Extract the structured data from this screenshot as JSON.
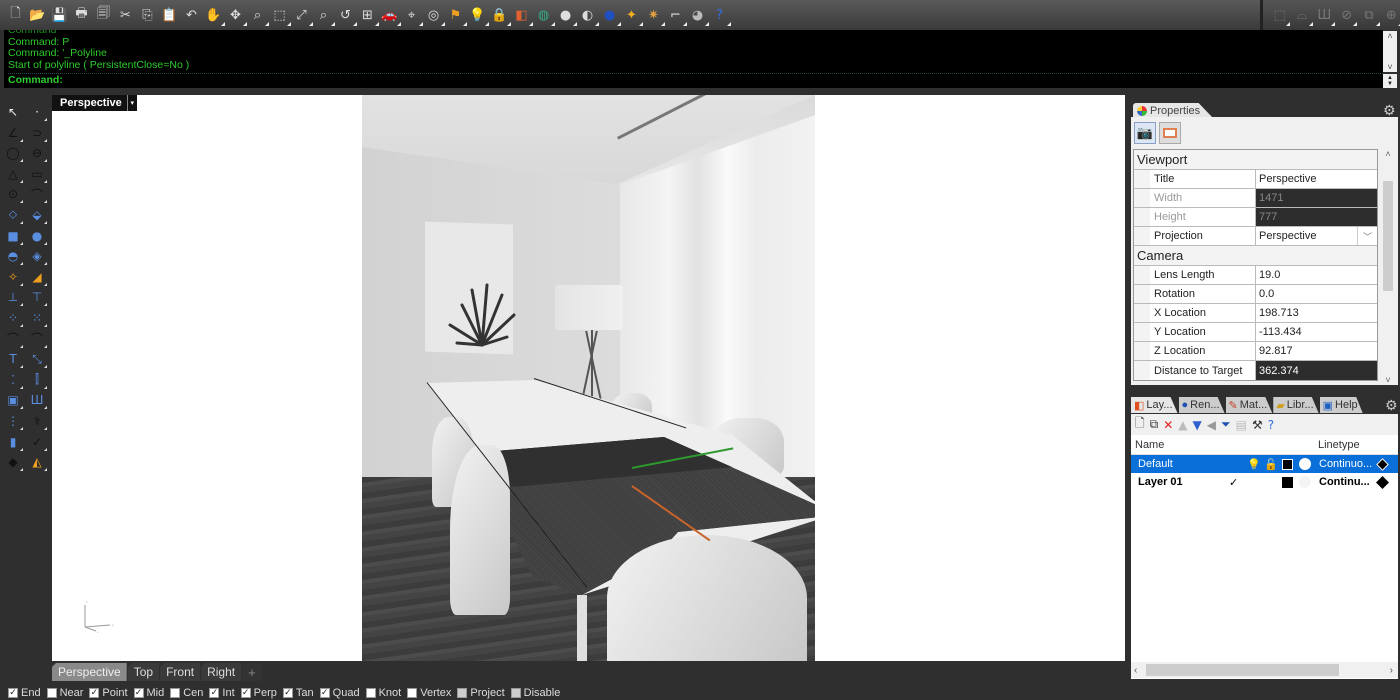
{
  "toolbar": {
    "icons": [
      "new-file-icon",
      "open-folder-icon",
      "save-icon",
      "print-icon",
      "copy-page-icon",
      "cut-icon",
      "copy-icon",
      "paste-icon",
      "undo-icon",
      "pan-hand-icon",
      "rotate-view-icon",
      "zoom-icon",
      "zoom-window-icon",
      "zoom-extents-icon",
      "zoom-selected-icon",
      "undo-view-icon",
      "viewport-layout-icon",
      "car-icon",
      "camera-icon",
      "target-icon",
      "named-view-icon",
      "light-bulb-icon",
      "lock-icon",
      "layer-icon",
      "color-wheel-icon",
      "sphere-shaded-icon",
      "sphere-rendered-icon",
      "sphere-blue-icon",
      "render-flash-icon",
      "gear-settings-icon",
      "group-icon",
      "globe-icon",
      "help-icon"
    ],
    "icon_glyphs": [
      "🗋",
      "📂",
      "💾",
      "🖶",
      "🗐",
      "✂",
      "⎘",
      "📋",
      "↶",
      "✋",
      "✥",
      "⌕",
      "⬚",
      "⤢",
      "⌕",
      "↺",
      "⊞",
      "🚗",
      "⌖",
      "◎",
      "⚑",
      "💡",
      "🔒",
      "◧",
      "◍",
      "●",
      "◐",
      "●",
      "✦",
      "✷",
      "⌐",
      "◕",
      "?"
    ],
    "right_icons": [
      "box-icon",
      "shelf-icon",
      "grass-icon",
      "no-entry-icon",
      "copy-block-icon",
      "plus-circle-icon"
    ],
    "right_glyphs": [
      "⬚",
      "⌓",
      "Ш",
      "⊘",
      "⧉",
      "⊕"
    ]
  },
  "command": {
    "history": [
      "Command",
      "Command: P",
      "Command: '_Polyline",
      "Start of polyline ( PersistentClose=No )"
    ],
    "prompt": "Command:",
    "scroll_up": "˄",
    "scroll_down": "˅"
  },
  "palette": {
    "icons": [
      "select-arrow-icon",
      "point-icon",
      "polyline-icon",
      "curve-icon",
      "circle-icon",
      "ellipse-icon",
      "polygon-icon",
      "rectangle-icon",
      "circle-center-icon",
      "arc-icon",
      "surface-corner-icon",
      "surface-loft-icon",
      "box-solid-icon",
      "sphere-union-icon",
      "extrude-icon",
      "mesh-icon",
      "explode-icon",
      "boolean-icon",
      "dimension-icon",
      "text-dot-icon",
      "points-icon",
      "control-points-icon",
      "fillet-curve-icon",
      "blend-icon",
      "text-icon",
      "scale-icon",
      "array-icon",
      "align-icon",
      "block-icon",
      "lights-icon",
      "grid-points-icon",
      "analyze-icon",
      "layers-solid-icon",
      "check-icon",
      "render-shapes-icon",
      "paint-bucket-icon"
    ],
    "glyphs": [
      "↖",
      "·",
      "∠",
      "⊃",
      "◯",
      "⊖",
      "△",
      "▭",
      "⊙",
      "⌒",
      "⬦",
      "⬙",
      "■",
      "●",
      "◓",
      "◈",
      "✧",
      "◢",
      "⊥",
      "⊤",
      "⁘",
      "⁙",
      "⌒",
      "⌒",
      "T",
      "⤡",
      "⁚",
      "⫿",
      "▣",
      "Ш",
      "⋮",
      "⚕",
      "▮",
      "✓",
      "◆",
      "◭"
    ]
  },
  "viewport": {
    "title": "Perspective",
    "menu_arrow": "▾"
  },
  "viewport_tabs": [
    {
      "label": "Perspective",
      "active": true
    },
    {
      "label": "Top",
      "active": false
    },
    {
      "label": "Front",
      "active": false
    },
    {
      "label": "Right",
      "active": false
    }
  ],
  "viewport_add": "+",
  "osnaps": [
    {
      "label": "End",
      "checked": true
    },
    {
      "label": "Near",
      "checked": false
    },
    {
      "label": "Point",
      "checked": true
    },
    {
      "label": "Mid",
      "checked": true
    },
    {
      "label": "Cen",
      "checked": false
    },
    {
      "label": "Int",
      "checked": true
    },
    {
      "label": "Perp",
      "checked": true
    },
    {
      "label": "Tan",
      "checked": true
    },
    {
      "label": "Quad",
      "checked": true
    },
    {
      "label": "Knot",
      "checked": false
    },
    {
      "label": "Vertex",
      "checked": false
    },
    {
      "label": "Project",
      "checked": false,
      "disabled": true
    },
    {
      "label": "Disable",
      "checked": false,
      "disabled": true
    }
  ],
  "properties": {
    "tab_label": "Properties",
    "sections": {
      "viewport": "Viewport",
      "camera": "Camera"
    },
    "viewport_rows": [
      {
        "key": "Title",
        "value": "Perspective"
      },
      {
        "key": "Width",
        "value": "1471"
      },
      {
        "key": "Height",
        "value": "777"
      },
      {
        "key": "Projection",
        "value": "Perspective"
      }
    ],
    "camera_rows": [
      {
        "key": "Lens Length",
        "value": "19.0"
      },
      {
        "key": "Rotation",
        "value": "0.0"
      },
      {
        "key": "X Location",
        "value": "198.713"
      },
      {
        "key": "Y Location",
        "value": "-113.434"
      },
      {
        "key": "Z Location",
        "value": "92.817"
      },
      {
        "key": "Distance to Target",
        "value": "362.374"
      }
    ]
  },
  "panel_tabs": [
    {
      "label": "Lay...",
      "icon": "layers-icon"
    },
    {
      "label": "Ren...",
      "icon": "render-icon"
    },
    {
      "label": "Mat...",
      "icon": "materials-icon"
    },
    {
      "label": "Libr...",
      "icon": "library-icon"
    },
    {
      "label": "Help",
      "icon": "help-icon"
    }
  ],
  "layers": {
    "toolbar": [
      "new-layer-icon",
      "new-sublayer-icon",
      "delete-icon",
      "move-up-icon",
      "move-down-icon",
      "move-parent-icon",
      "filter-icon",
      "clipboard-icon",
      "tools-icon",
      "help-icon"
    ],
    "toolbar_glyphs": [
      "🗋",
      "⧉",
      "✕",
      "▲",
      "▼",
      "◀",
      "⏷",
      "▤",
      "⚒",
      "?"
    ],
    "columns": {
      "name": "Name",
      "linetype": "Linetype"
    },
    "rows": [
      {
        "name": "Default",
        "selected": true,
        "current": false,
        "linetype": "Continuo...",
        "color": "#000000"
      },
      {
        "name": "Layer 01",
        "selected": false,
        "current": true,
        "linetype": "Continu...",
        "color": "#000000"
      }
    ],
    "check_mark": "✓"
  },
  "colors": {
    "command_text": "#2ecc2e",
    "selection_blue": "#0a6fd8",
    "x_axis": "#c8632a",
    "y_axis": "#2e9a2e"
  }
}
